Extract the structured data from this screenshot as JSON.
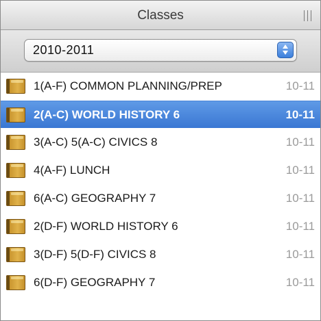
{
  "header": {
    "title": "Classes",
    "grip_icon": "column-resize-grip-icon"
  },
  "year_select": {
    "value": "2010-2011",
    "arrow_icon": "up-down-arrows-icon"
  },
  "classes": [
    {
      "name": "1(A-F) COMMON PLANNING/PREP",
      "year": "10-11",
      "selected": false,
      "icon": "folder-icon"
    },
    {
      "name": "2(A-C) WORLD HISTORY 6",
      "year": "10-11",
      "selected": true,
      "icon": "folder-icon"
    },
    {
      "name": "3(A-C) 5(A-C) CIVICS 8",
      "year": "10-11",
      "selected": false,
      "icon": "folder-icon"
    },
    {
      "name": "4(A-F) LUNCH",
      "year": "10-11",
      "selected": false,
      "icon": "folder-icon"
    },
    {
      "name": "6(A-C) GEOGRAPHY 7",
      "year": "10-11",
      "selected": false,
      "icon": "folder-icon"
    },
    {
      "name": "2(D-F) WORLD HISTORY 6",
      "year": "10-11",
      "selected": false,
      "icon": "folder-icon"
    },
    {
      "name": "3(D-F) 5(D-F) CIVICS 8",
      "year": "10-11",
      "selected": false,
      "icon": "folder-icon"
    },
    {
      "name": "6(D-F) GEOGRAPHY 7",
      "year": "10-11",
      "selected": false,
      "icon": "folder-icon"
    }
  ],
  "colors": {
    "selection": "#3a77d3",
    "year_text": "#9a9a9a",
    "folder": "#e0b24a"
  }
}
